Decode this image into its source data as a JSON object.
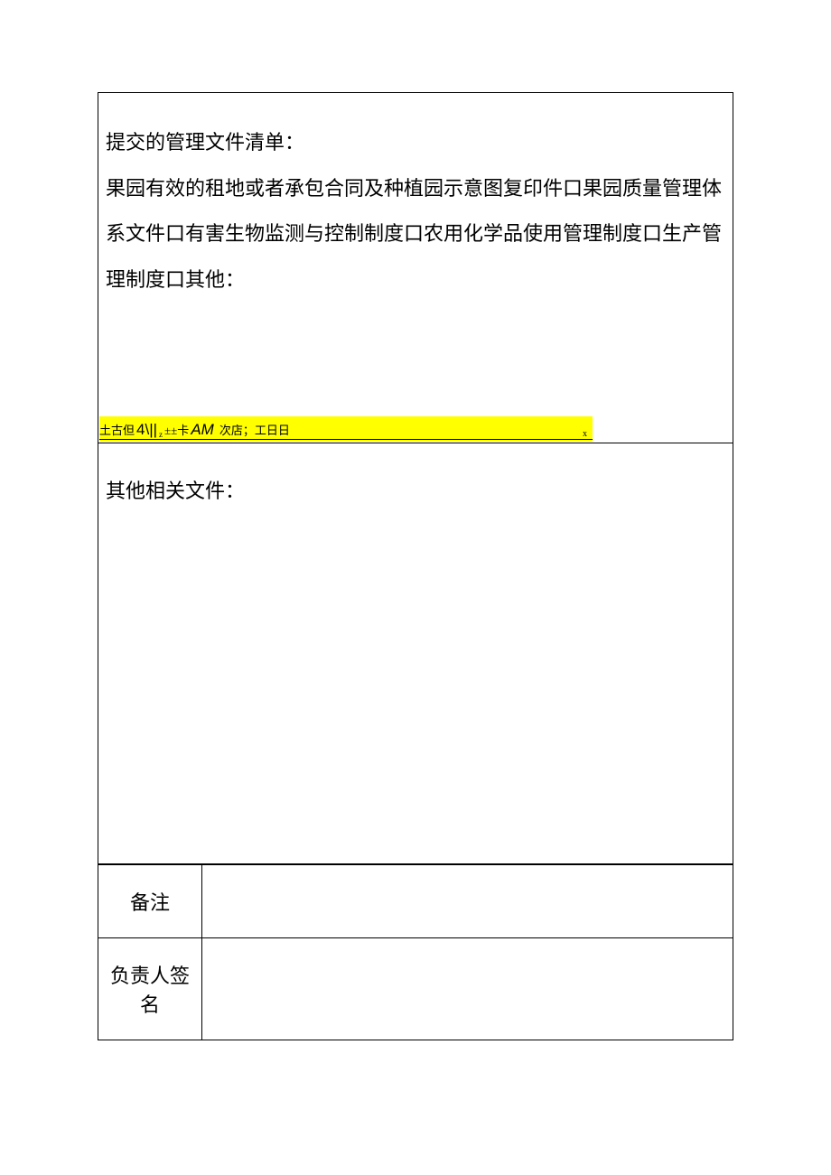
{
  "section1": {
    "title": "提交的管理文件清单：",
    "body": "果园有效的租地或者承包合同及种植园示意图复印件口果园质量管理体系文件口有害生物监测与控制制度口农用化学品使用管理制度口生产管理制度口其他："
  },
  "highlight": {
    "prefix": "土古但",
    "big1": "4\\||",
    "sub": "z",
    "mid": "±±卡",
    "am": "AM",
    "cn": "次店；工日日",
    "right": "x"
  },
  "section2": {
    "title": "其他相关文件："
  },
  "rows": {
    "remark_label": "备注",
    "remark_value": "",
    "signature_label": "负责人签名",
    "signature_value": ""
  }
}
